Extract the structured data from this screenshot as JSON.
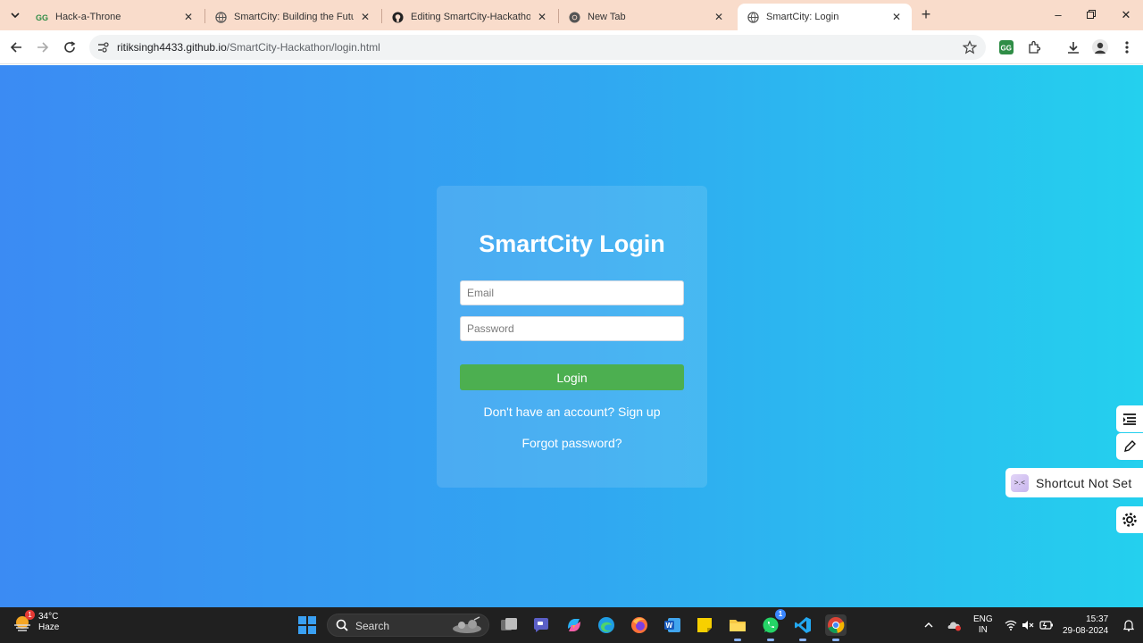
{
  "browser": {
    "tabs": [
      {
        "title": "Hack-a-Throne",
        "favicon": "geeksforgeeks-icon",
        "active": false
      },
      {
        "title": "SmartCity: Building the Future",
        "favicon": "globe-icon",
        "active": false
      },
      {
        "title": "Editing SmartCity-Hackathon/R",
        "favicon": "github-icon",
        "active": false
      },
      {
        "title": "New Tab",
        "favicon": "chrome-icon",
        "active": false
      },
      {
        "title": "SmartCity: Login",
        "favicon": "globe-icon",
        "active": true
      }
    ],
    "url_host": "ritiksingh4433.github.io",
    "url_path": "/SmartCity-Hackathon/login.html"
  },
  "login": {
    "heading": "SmartCity Login",
    "email_placeholder": "Email",
    "password_placeholder": "Password",
    "login_button": "Login",
    "signup_link": "Don't have an account? Sign up",
    "forgot_link": "Forgot password?"
  },
  "overlay": {
    "shortcut_label": "Shortcut Not Set"
  },
  "taskbar": {
    "weather_temp": "34°C",
    "weather_desc": "Haze",
    "weather_badge": "1",
    "search_placeholder": "Search",
    "whatsapp_badge": "1",
    "lang_line1": "ENG",
    "lang_line2": "IN",
    "time": "15:37",
    "date": "29-08-2024"
  },
  "colors": {
    "page_gradient_start": "#3b8bf3",
    "page_gradient_end": "#24d0ee",
    "login_button": "#4caf50",
    "tabstrip": "#f9dccb"
  }
}
